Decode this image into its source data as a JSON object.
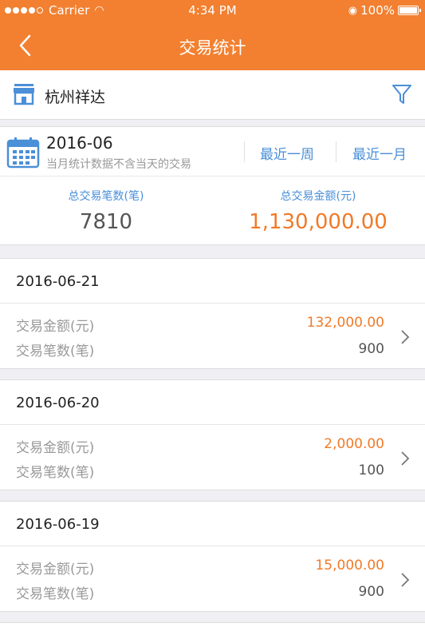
{
  "statusbar": {
    "carrier": "Carrier",
    "time": "4:34 PM",
    "battery_text": "100%"
  },
  "navbar": {
    "title": "交易统计",
    "back_icon": "chevron-left-icon"
  },
  "shop": {
    "name": "杭州祥达",
    "icon": "store-icon",
    "filter_icon": "funnel-filter-icon"
  },
  "summary": {
    "month": "2016-06",
    "note": "当月统计数据不含当天的交易",
    "recent_week": "最近一周",
    "recent_month": "最近一月",
    "total_count_label": "总交易笔数(笔)",
    "total_count": "7810",
    "total_amount_label": "总交易金额(元)",
    "total_amount": "1,130,000.00"
  },
  "days": [
    {
      "date": "2016-06-21",
      "amount_label": "交易金额(元)",
      "amount": "132,000.00",
      "count_label": "交易笔数(笔)",
      "count": "900"
    },
    {
      "date": "2016-06-20",
      "amount_label": "交易金额(元)",
      "amount": "2,000.00",
      "count_label": "交易笔数(笔)",
      "count": "100"
    },
    {
      "date": "2016-06-19",
      "amount_label": "交易金额(元)",
      "amount": "15,000.00",
      "count_label": "交易笔数(笔)",
      "count": "900"
    }
  ],
  "colors": {
    "brand_orange": "#f28030",
    "accent_blue": "#4a8fd8",
    "amount_orange": "#f07a28"
  }
}
